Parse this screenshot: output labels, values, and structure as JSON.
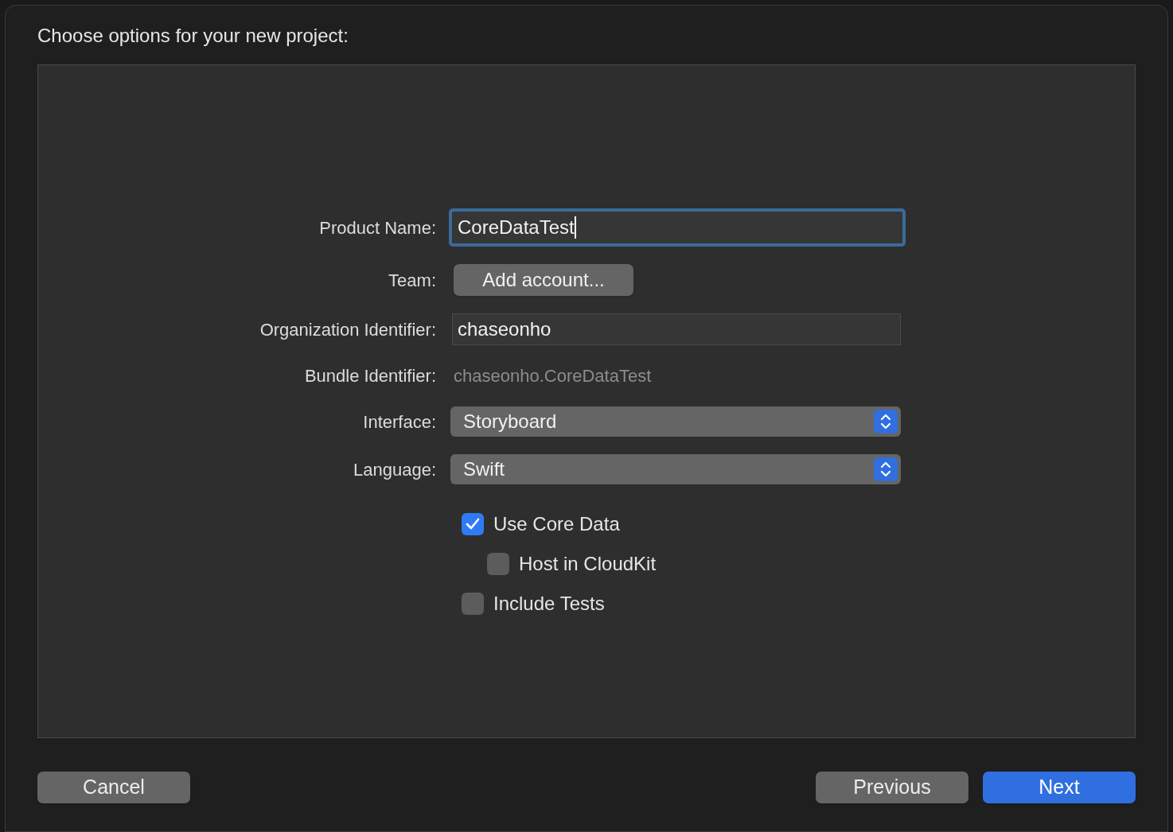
{
  "title": "Choose options for your new project:",
  "form": [
    {
      "kind": "text",
      "label": "Product Name:",
      "value": "CoreDataTest",
      "focused": true
    },
    {
      "kind": "button",
      "label": "Team:",
      "value": "Add account..."
    },
    {
      "kind": "text",
      "label": "Organization Identifier:",
      "value": "chaseonho",
      "focused": false
    },
    {
      "kind": "static",
      "label": "Bundle Identifier:",
      "value": "chaseonho.CoreDataTest"
    },
    {
      "kind": "popup",
      "label": "Interface:",
      "value": "Storyboard"
    },
    {
      "kind": "popup",
      "label": "Language:",
      "value": "Swift"
    }
  ],
  "options": [
    {
      "label": "Use Core Data",
      "checked": true,
      "children": [
        {
          "label": "Host in CloudKit",
          "checked": false
        }
      ]
    },
    {
      "label": "Include Tests",
      "checked": false
    }
  ],
  "footer": {
    "left": [
      {
        "label": "Cancel",
        "default": false
      }
    ],
    "right": [
      {
        "label": "Previous",
        "default": false
      },
      {
        "label": "Next",
        "default": true
      }
    ]
  }
}
